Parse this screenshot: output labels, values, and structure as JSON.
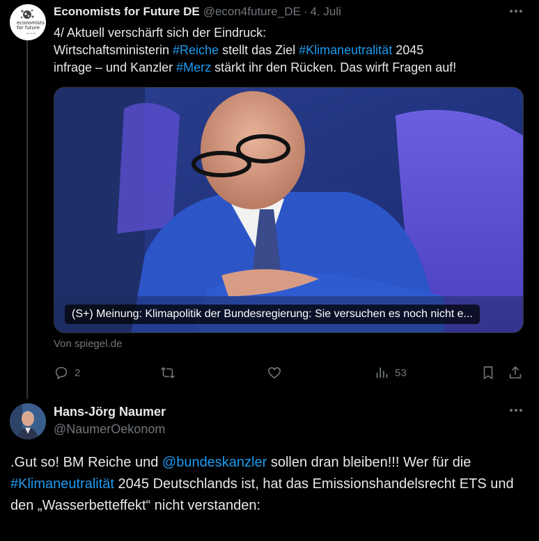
{
  "tweet1": {
    "author_name": "Economists for Future DE",
    "handle": "@econ4future_DE",
    "separator": "·",
    "date": "4. Juli",
    "avatar_logo_text": "economists for future",
    "avatar_small_text": "DE 2C 4S",
    "more_icon": "more-horizontal-icon",
    "text_segments": [
      {
        "text": "4/ Aktuell verschärft sich der Eindruck:",
        "type": "text"
      },
      {
        "text": "Wirtschaftsministerin ",
        "type": "text"
      },
      {
        "text": "#Reiche",
        "type": "hashtag"
      },
      {
        "text": " stellt das Ziel ",
        "type": "text"
      },
      {
        "text": "#Klimaneutralität",
        "type": "hashtag"
      },
      {
        "text": " 2045",
        "type": "text"
      },
      {
        "text": "infrage – und Kanzler ",
        "type": "text"
      },
      {
        "text": "#Merz",
        "type": "hashtag"
      },
      {
        "text": " stärkt ihr den Rücken. Das wirft Fragen auf!",
        "type": "text"
      }
    ],
    "link_card": {
      "caption": "(S+) Meinung: Klimapolitik der Bundesregierung: Sie versuchen es noch nicht e...",
      "source": "Von spiegel.de"
    },
    "actions": {
      "replies": "2",
      "retweets": "",
      "likes": "",
      "views": "53"
    }
  },
  "tweet2": {
    "author_name": "Hans-Jörg Naumer",
    "handle": "@NaumerOekonom",
    "more_icon": "more-horizontal-icon",
    "text_segments": [
      {
        "text": ".Gut so! BM Reiche und ",
        "type": "text"
      },
      {
        "text": "@bundeskanzler",
        "type": "mention"
      },
      {
        "text": " sollen dran bleiben!!! Wer für die ",
        "type": "text"
      },
      {
        "text": "#Klimaneutralität",
        "type": "hashtag"
      },
      {
        "text": " 2045 Deutschlands ist, hat das Emissionshandelsrecht ETS und den „Wasserbetteffekt“ nicht verstanden:",
        "type": "text"
      }
    ]
  },
  "colors": {
    "background": "#000000",
    "text": "#e7e9ea",
    "secondary": "#71767b",
    "accent": "#1d9bf0",
    "divider": "#2f3336"
  }
}
